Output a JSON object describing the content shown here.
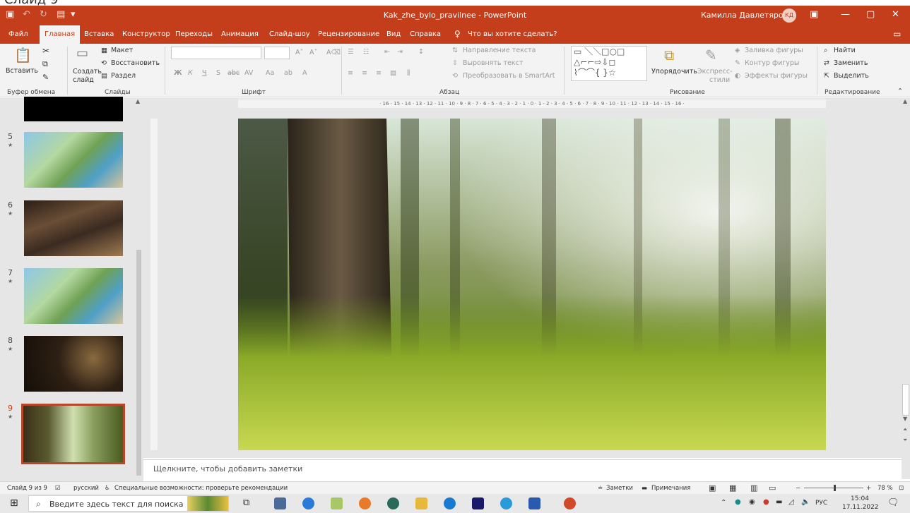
{
  "caption": "Слайд 9",
  "titlebar": {
    "doc_title": "Kak_zhe_bylo_pravilnee - PowerPoint",
    "user_name": "Камилла Давлетярова",
    "user_initials": "КД"
  },
  "menu": {
    "tabs": [
      "Файл",
      "Главная",
      "Вставка",
      "Конструктор",
      "Переходы",
      "Анимация",
      "Слайд-шоу",
      "Рецензирование",
      "Вид",
      "Справка"
    ],
    "tell_me": "Что вы хотите сделать?"
  },
  "ribbon": {
    "paste": "Вставить",
    "clipboard_group": "Буфер обмена",
    "layout": "Макет",
    "reset": "Восстановить",
    "new_slide_1": "Создать",
    "new_slide_2": "слайд",
    "section": "Раздел",
    "slides_group": "Слайды",
    "font_group": "Шрифт",
    "text_direction": "Направление текста",
    "align_text": "Выровнять текст",
    "smartart": "Преобразовать в SmartArt",
    "paragraph_group": "Абзац",
    "arrange": "Упорядочить",
    "quick_styles_1": "Экспресс-",
    "quick_styles_2": "стили",
    "shape_fill": "Заливка фигуры",
    "shape_outline": "Контур фигуры",
    "shape_effects": "Эффекты фигуры",
    "drawing_group": "Рисование",
    "find": "Найти",
    "replace": "Заменить",
    "select": "Выделить",
    "editing_group": "Редактирование"
  },
  "slides": [
    {
      "num": "5"
    },
    {
      "num": "6"
    },
    {
      "num": "7"
    },
    {
      "num": "8"
    },
    {
      "num": "9"
    }
  ],
  "hruler": "· 16 · 15 · 14 · 13 · 12 · 11 · 10 · 9 · 8 · 7 · 6 · 5 · 4 · 3 · 2 · 1 · 0 · 1 · 2 · 3 · 4 · 5 · 6 · 7 · 8 · 9 · 10 · 11 · 12 · 13 · 14 · 15 · 16 ·",
  "notes_placeholder": "Щелкните, чтобы добавить заметки",
  "status": {
    "slide_counter": "Слайд 9 из 9",
    "language": "русский",
    "accessibility": "Специальные возможности: проверьте рекомендации",
    "notes": "Заметки",
    "comments": "Примечания",
    "zoom": "78 %"
  },
  "taskbar": {
    "search_placeholder": "Введите здесь текст для поиска",
    "lang": "РУС",
    "time": "15:04",
    "date": "17.11.2022"
  }
}
